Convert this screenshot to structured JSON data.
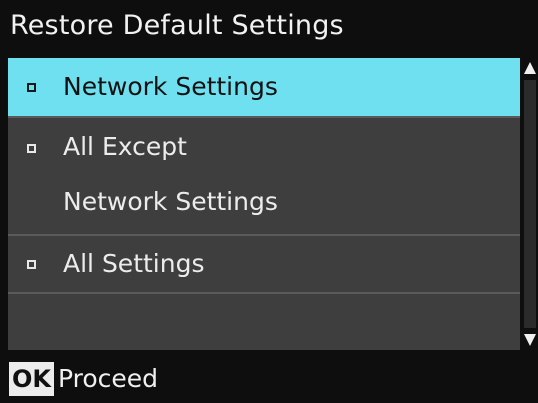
{
  "title": "Restore Default Settings",
  "menu": {
    "items": [
      {
        "lines": [
          "Network Settings"
        ],
        "selected": true
      },
      {
        "lines": [
          "All Except",
          "Network Settings"
        ],
        "selected": false
      },
      {
        "lines": [
          "All Settings"
        ],
        "selected": false
      }
    ]
  },
  "footer": {
    "ok_key": "OK",
    "action_label": "Proceed"
  },
  "colors": {
    "selection": "#6fe0ef",
    "list_background": "#3e3e3e",
    "screen_background": "#0e0e0e"
  },
  "icons": [
    "bullet-square-icon",
    "scroll-up-arrow-icon",
    "scroll-down-arrow-icon"
  ]
}
